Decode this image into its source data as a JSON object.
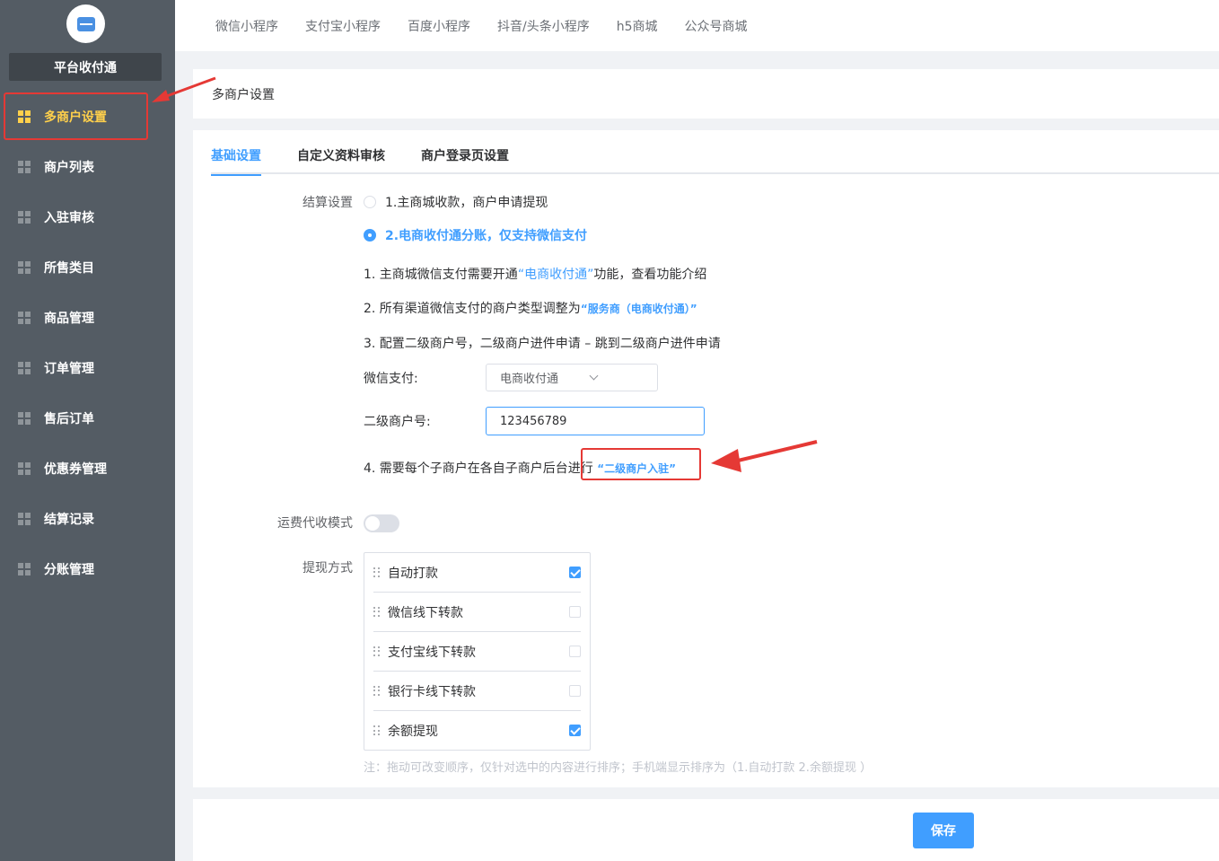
{
  "sidebar": {
    "brand": "平台收付通",
    "items": [
      {
        "label": "多商户设置",
        "active": true
      },
      {
        "label": "商户列表"
      },
      {
        "label": "入驻审核"
      },
      {
        "label": "所售类目"
      },
      {
        "label": "商品管理"
      },
      {
        "label": "订单管理"
      },
      {
        "label": "售后订单"
      },
      {
        "label": "优惠券管理"
      },
      {
        "label": "结算记录"
      },
      {
        "label": "分账管理"
      }
    ]
  },
  "topnav": [
    "微信小程序",
    "支付宝小程序",
    "百度小程序",
    "抖音/头条小程序",
    "h5商城",
    "公众号商城"
  ],
  "page_title": "多商户设置",
  "tabs": [
    "基础设置",
    "自定义资料审核",
    "商户登录页设置"
  ],
  "settlement": {
    "label": "结算设置",
    "option1": "1.主商城收款，商户申请提现",
    "option2": "2.电商收付通分账，仅支持微信支付",
    "step1_pre": "1. 主商城微信支付需要开通",
    "step1_link": "“电商收付通”",
    "step1_post": "功能，查看功能介绍",
    "step2_pre": "2. 所有渠道微信支付的商户类型调整为",
    "step2_link": "“服务商（电商收付通）”",
    "step3": "3. 配置二级商户号，二级商户进件申请 – 跳到二级商户进件申请",
    "wechat_pay_label": "微信支付:",
    "wechat_pay_value": "电商收付通",
    "sub_merchant_label": "二级商户号:",
    "sub_merchant_value": "123456789",
    "step4_pre": "4. 需要每个子商户在各自子商户后台进行",
    "step4_link": "“二级商户入驻”"
  },
  "freight": {
    "label": "运费代收模式",
    "enabled": false
  },
  "withdraw": {
    "label": "提现方式",
    "items": [
      {
        "label": "自动打款",
        "checked": true
      },
      {
        "label": "微信线下转款",
        "checked": false
      },
      {
        "label": "支付宝线下转款",
        "checked": false
      },
      {
        "label": "银行卡线下转款",
        "checked": false
      },
      {
        "label": "余额提现",
        "checked": true
      }
    ],
    "note": "注：拖动可改变顺序，仅针对选中的内容进行排序；手机端显示排序为（1.自动打款 2.余额提现 ）"
  },
  "save_label": "保存",
  "colors": {
    "sidebar": "#545c64",
    "active": "#ffd04b",
    "primary": "#409eff",
    "annotation": "#e53935"
  }
}
